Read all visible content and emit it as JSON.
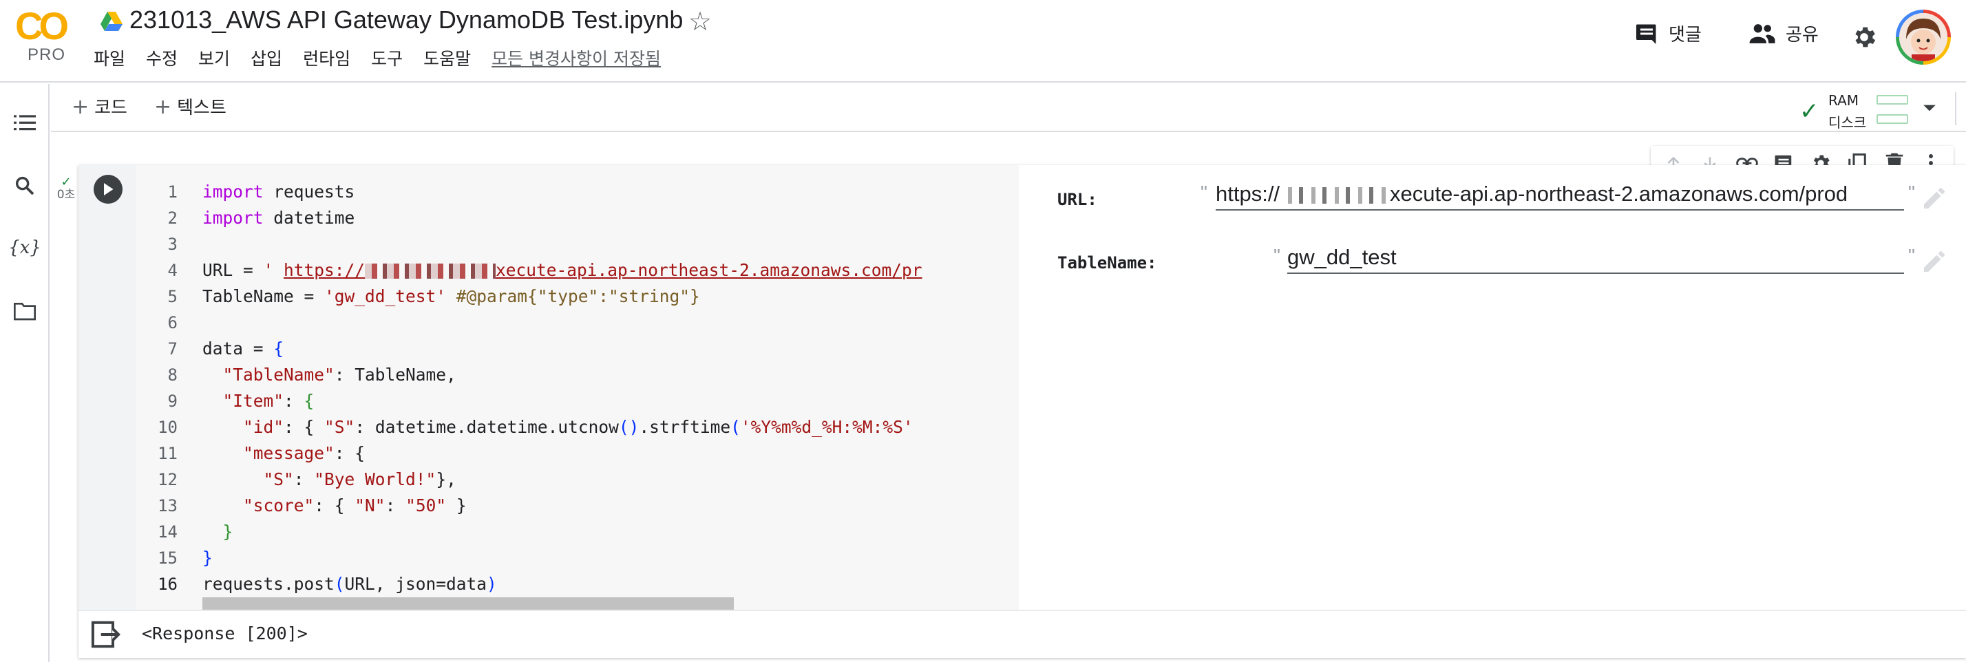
{
  "app": {
    "logo_text": "CO",
    "logo_sub": "PRO",
    "title": "231013_AWS API Gateway DynamoDB Test.ipynb",
    "menu": [
      "파일",
      "수정",
      "보기",
      "삽입",
      "런타임",
      "도구",
      "도움말"
    ],
    "saved_status": "모든 변경사항이 저장됨",
    "comments_label": "댓글",
    "share_label": "공유"
  },
  "toolbar": {
    "add_code": "코드",
    "add_text": "텍스트",
    "ram_label": "RAM",
    "disk_label": "디스크"
  },
  "cell": {
    "exec_time": "0초",
    "line_numbers": [
      "1",
      "2",
      "3",
      "4",
      "5",
      "6",
      "7",
      "8",
      "9",
      "10",
      "11",
      "12",
      "13",
      "14",
      "15",
      "16"
    ],
    "code": {
      "l1_kw": "import",
      "l1_rest": " requests",
      "l2_kw": "import",
      "l2_rest": " datetime",
      "l4_a": "URL = ",
      "l4_q": "' ",
      "l4_url_a": "https://",
      "l4_url_b": "xecute-api.ap-northeast-2.amazonaws.com/pr",
      "l5_a": "TableName = ",
      "l5_str": "'gw_dd_test'",
      "l5_sp": " ",
      "l5_param": "#@param{\"type\":\"string\"}",
      "l7_a": "data = ",
      "l7_b": "{",
      "l8_ind": "  ",
      "l8_key": "\"TableName\"",
      "l8_rest": ": TableName,",
      "l9_ind": "  ",
      "l9_key": "\"Item\"",
      "l9_rest": ": ",
      "l9_b": "{",
      "l10_ind": "    ",
      "l10_key": "\"id\"",
      "l10_a": ": { ",
      "l10_s": "\"S\"",
      "l10_b": ": datetime.datetime.utcnow",
      "l10_p": "()",
      "l10_c": ".strftime",
      "l10_p2": "(",
      "l10_fmt": "'%Y%m%d_%H:%M:%S'",
      "l11_ind": "    ",
      "l11_key": "\"message\"",
      "l11_a": ": {",
      "l12_ind": "      ",
      "l12_s": "\"S\"",
      "l12_a": ": ",
      "l12_v": "\"Bye World!\"",
      "l12_b": "},",
      "l13_ind": "    ",
      "l13_key": "\"score\"",
      "l13_a": ": { ",
      "l13_n": "\"N\"",
      "l13_b": ": ",
      "l13_v": "\"50\"",
      "l13_c": " }",
      "l14_ind": "  ",
      "l14_b": "}",
      "l15_b": "}",
      "l16_a": "requests.post",
      "l16_p": "(",
      "l16_b": "URL, json=data",
      "l16_p2": ")"
    },
    "form": {
      "url_label": "URL:",
      "url_value_a": "https://",
      "url_value_b": "xecute-api.ap-northeast-2.amazonaws.com/prod",
      "table_label": "TableName:",
      "table_value": "gw_dd_test"
    },
    "output": "<Response [200]>"
  },
  "colors": {
    "accent_green": "#188038",
    "logo_orange": "#f9ab00",
    "keyword": "#af00db",
    "string": "#a31515"
  },
  "icons": [
    "drive-icon",
    "star-icon",
    "comment-icon",
    "people-icon",
    "gear-icon",
    "avatar",
    "toc-icon",
    "search-icon",
    "variables-icon",
    "folder-icon",
    "check-icon",
    "caret-down-icon",
    "chevron-up-icon",
    "arrow-up-icon",
    "arrow-down-icon",
    "link-icon",
    "comment-icon",
    "gear-icon",
    "mirror-icon",
    "trash-icon",
    "more-vert-icon",
    "run-icon",
    "pencil-icon",
    "output-icon"
  ]
}
